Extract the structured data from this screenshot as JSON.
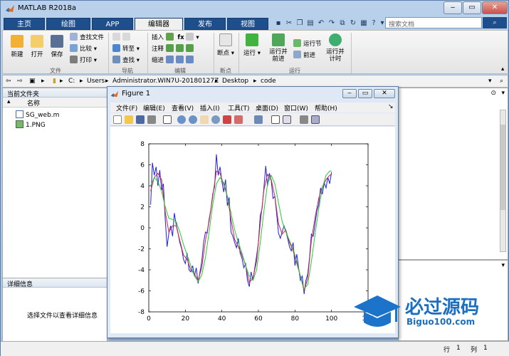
{
  "app": {
    "title": "MATLAB R2018a"
  },
  "tabs": [
    {
      "label": "主页"
    },
    {
      "label": "绘图"
    },
    {
      "label": "APP"
    },
    {
      "label": "编辑器"
    },
    {
      "label": "发布"
    },
    {
      "label": "视图"
    }
  ],
  "search": {
    "placeholder": "搜索文档"
  },
  "ribbon": {
    "file": {
      "new": "新建",
      "open": "打开",
      "save": "保存",
      "find_files": "查找文件",
      "compare": "比较",
      "print": "打印",
      "group": "文件"
    },
    "navigate": {
      "goto": "转至",
      "find": "查找",
      "group": "导航"
    },
    "edit": {
      "insert": "插入",
      "comment": "注释",
      "indent": "缩进",
      "fx": "fx",
      "group": "编辑"
    },
    "breakpoints": {
      "breakpoint": "断点",
      "group": "断点"
    },
    "run": {
      "run": "运行",
      "run_advance": "运行并\n前进",
      "run_section": "运行节",
      "advance": "前进",
      "run_time": "运行并\n计时",
      "group": "运行"
    }
  },
  "address": {
    "crumbs": [
      "C:",
      "Users",
      "Administrator.WIN7U-20180127Z",
      "Desktop",
      "code"
    ]
  },
  "current_folder": {
    "title": "当前文件夹",
    "column_name": "名称",
    "files": [
      {
        "name": "SG_web.m",
        "icon": "m-file-icon"
      },
      {
        "name": "1.PNG",
        "icon": "image-file-icon"
      }
    ]
  },
  "details": {
    "title": "详细信息",
    "empty_text": "选择文件以查看详细信息"
  },
  "statusbar": {
    "row_label": "行",
    "row_value": "1",
    "col_label": "列",
    "col_value": "1"
  },
  "figure": {
    "title": "Figure 1",
    "menus": [
      "文件(F)",
      "编辑(E)",
      "查看(V)",
      "插入(I)",
      "工具(T)",
      "桌面(D)",
      "窗口(W)",
      "帮助(H)"
    ]
  },
  "watermark": {
    "text": "必过源码",
    "url": "Biguo100.com"
  },
  "colors": {
    "blue_line": "#1f1fe0",
    "red_line": "#d0204a",
    "green_line": "#22cc33",
    "tab_blue": "#1e4e8c"
  },
  "chart_data": {
    "type": "line",
    "xlim": [
      0,
      120
    ],
    "ylim": [
      -8,
      8
    ],
    "xticks": [
      0,
      20,
      40,
      60,
      80,
      100,
      120
    ],
    "yticks": [
      8,
      6,
      4,
      2,
      0,
      -2,
      -4,
      -6,
      -8
    ],
    "grid": false,
    "series": [
      {
        "color": "#1f1fe0",
        "x": [
          1,
          2,
          3,
          4,
          5,
          6,
          7,
          8,
          9,
          10,
          11,
          12,
          13,
          14,
          15,
          16,
          17,
          18,
          19,
          20,
          21,
          22,
          23,
          24,
          25,
          26,
          27,
          28,
          29,
          30,
          31,
          32,
          33,
          34,
          35,
          36,
          37,
          38,
          39,
          40,
          41,
          42,
          43,
          44,
          45,
          46,
          47,
          48,
          49,
          50,
          51,
          52,
          53,
          54,
          55,
          56,
          57,
          58,
          59,
          60,
          61,
          62,
          63,
          64,
          65,
          66,
          67,
          68,
          69,
          70,
          71,
          72,
          73,
          74,
          75,
          76,
          77,
          78,
          79,
          80,
          81,
          82,
          83,
          84,
          85,
          86,
          87,
          88,
          89,
          90,
          91,
          92,
          93,
          94,
          95,
          96,
          97,
          98,
          99,
          100
        ],
        "y": [
          2.2,
          6.2,
          5.0,
          5.8,
          4.0,
          5.5,
          3.6,
          4.2,
          0.8,
          -1.8,
          -0.5,
          0.2,
          -0.8,
          1.4,
          0.3,
          -0.5,
          -1.4,
          -2.0,
          -3.0,
          -3.4,
          -2.4,
          -4.0,
          -4.2,
          -3.6,
          -4.6,
          -3.8,
          -5.3,
          -4.2,
          -3.2,
          -1.4,
          -0.4,
          -0.5,
          0.8,
          1.8,
          3.2,
          3.9,
          7.0,
          5.0,
          5.8,
          4.4,
          3.4,
          4.6,
          2.1,
          2.9,
          -0.4,
          -0.8,
          -1.4,
          -1.9,
          -1.0,
          -2.4,
          -2.9,
          -3.8,
          -3.4,
          -5.0,
          -5.6,
          -4.2,
          -5.0,
          -3.8,
          -2.7,
          -1.4,
          1.2,
          1.8,
          3.8,
          5.9,
          4.0,
          5.2,
          4.5,
          2.8,
          3.0,
          1.3,
          -0.5,
          -1.0,
          -0.4,
          0.2,
          -0.3,
          -1.0,
          -1.8,
          -2.2,
          -1.4,
          -3.6,
          -2.5,
          -3.8,
          -5.0,
          -4.6,
          -6.3,
          -5.0,
          -4.4,
          -2.8,
          -0.6,
          -0.8,
          0.4,
          1.6,
          2.2,
          3.8,
          3.2,
          4.3,
          3.8,
          4.8,
          4.2,
          5.3
        ]
      },
      {
        "color": "#d0204a",
        "x": [
          1,
          3,
          5,
          7,
          9,
          11,
          13,
          15,
          17,
          19,
          21,
          23,
          25,
          27,
          29,
          31,
          33,
          35,
          37,
          39,
          41,
          43,
          45,
          47,
          49,
          51,
          53,
          55,
          57,
          59,
          61,
          63,
          65,
          67,
          69,
          71,
          73,
          75,
          77,
          79,
          81,
          83,
          85,
          87,
          89,
          91,
          93,
          95,
          97,
          99,
          100
        ],
        "y": [
          3.5,
          4.8,
          5.2,
          4.6,
          1.5,
          -0.4,
          0.2,
          0.2,
          -1.2,
          -2.6,
          -3.0,
          -4.0,
          -4.4,
          -5.0,
          -3.8,
          -1.2,
          0.6,
          3.0,
          5.4,
          5.2,
          4.1,
          3.0,
          0.8,
          -1.1,
          -1.8,
          -2.6,
          -3.6,
          -5.2,
          -4.8,
          -3.2,
          0.4,
          3.6,
          5.1,
          4.6,
          3.0,
          0.4,
          -0.6,
          -0.2,
          -1.4,
          -2.2,
          -3.4,
          -4.6,
          -6.0,
          -4.8,
          -1.2,
          1.0,
          2.8,
          3.9,
          4.6,
          5.0,
          5.1
        ]
      },
      {
        "color": "#22cc33",
        "x": [
          1,
          3,
          5,
          7,
          9,
          11,
          13,
          15,
          17,
          19,
          21,
          23,
          25,
          27,
          29,
          31,
          33,
          35,
          37,
          39,
          41,
          43,
          45,
          47,
          49,
          51,
          53,
          55,
          57,
          59,
          61,
          63,
          65,
          67,
          69,
          71,
          73,
          75,
          77,
          79,
          81,
          83,
          85,
          87,
          89,
          91,
          93,
          95,
          97,
          99,
          100
        ],
        "y": [
          4.0,
          4.8,
          4.4,
          3.5,
          2.0,
          0.9,
          0.8,
          0.6,
          -0.4,
          -1.6,
          -2.6,
          -3.6,
          -4.6,
          -5.1,
          -4.5,
          -2.8,
          -0.4,
          2.2,
          4.2,
          4.8,
          4.3,
          3.0,
          1.4,
          -0.2,
          -1.4,
          -2.4,
          -3.6,
          -4.6,
          -5.0,
          -4.0,
          -1.4,
          1.6,
          4.2,
          5.0,
          4.2,
          2.4,
          0.6,
          -0.4,
          -1.2,
          -2.0,
          -3.2,
          -4.6,
          -5.8,
          -5.4,
          -3.2,
          -0.6,
          1.8,
          3.8,
          5.0,
          5.4,
          5.4
        ]
      }
    ]
  }
}
